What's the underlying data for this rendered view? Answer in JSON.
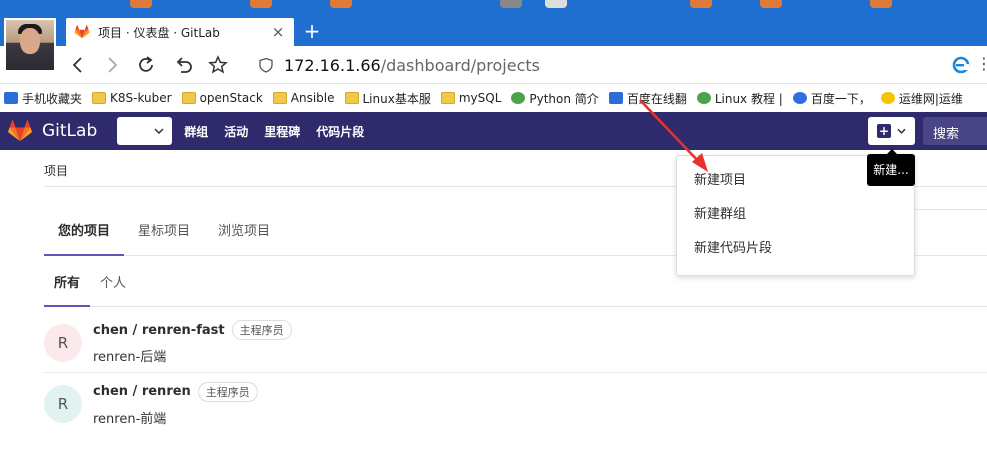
{
  "browser": {
    "tab_title": "项目 · 仪表盘 · GitLab",
    "tab_close": "×",
    "new_tab": "+",
    "url_host": "172.16.1.66",
    "url_path": "/dashboard/projects",
    "menu_dots": "⋮"
  },
  "bookmarks": [
    {
      "label": "手机收藏夹",
      "icon": "blue"
    },
    {
      "label": "K8S-kuber",
      "icon": "folder"
    },
    {
      "label": "openStack",
      "icon": "folder"
    },
    {
      "label": "Ansible",
      "icon": "folder"
    },
    {
      "label": "Linux基本服",
      "icon": "folder"
    },
    {
      "label": "mySQL",
      "icon": "folder"
    },
    {
      "label": "Python 简介",
      "icon": "green"
    },
    {
      "label": "百度在线翻",
      "icon": "blue"
    },
    {
      "label": "Linux 教程 |",
      "icon": "green"
    },
    {
      "label": "百度一下，",
      "icon": "baidu"
    },
    {
      "label": "运维网|运维",
      "icon": "yellow"
    }
  ],
  "gitlab": {
    "brand": "GitLab",
    "nav": [
      "群组",
      "活动",
      "里程碑",
      "代码片段"
    ],
    "search_placeholder": "搜索",
    "tooltip": "新建...",
    "dropdown_items": [
      "新建项目",
      "新建群组",
      "新建代码片段"
    ]
  },
  "page": {
    "breadcrumb": "项目",
    "main_tabs": [
      "您的项目",
      "星标项目",
      "浏览项目"
    ],
    "sub_tabs": [
      "所有",
      "个人"
    ],
    "projects": [
      {
        "avatar_letter": "R",
        "avatar_color": "#fbe9eb",
        "name": "chen / renren-fast",
        "role": "主程序员",
        "description": "renren-后端"
      },
      {
        "avatar_letter": "R",
        "avatar_color": "#e1f3f0",
        "name": "chen / renren",
        "role": "主程序员",
        "description": "renren-前端"
      }
    ]
  },
  "colors": {
    "browser_blue": "#1f6fd0",
    "gitlab_header": "#2f2a6b",
    "tab_underline": "#6b4fbb",
    "annotation_arrow": "#e8312a"
  }
}
